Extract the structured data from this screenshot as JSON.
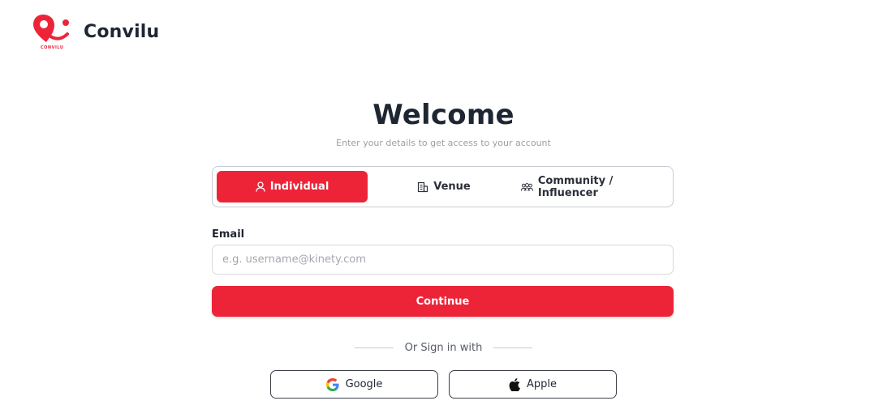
{
  "brand": {
    "name": "Convilu",
    "logo_text": "CONVILU",
    "accent": "#ed2438"
  },
  "header": {
    "title": "Welcome",
    "subtitle": "Enter your details to get access to your account"
  },
  "tabs": [
    {
      "label": "Individual",
      "icon": "person-icon",
      "active": true
    },
    {
      "label": "Venue",
      "icon": "building-icon",
      "active": false
    },
    {
      "label": "Community / Influencer",
      "icon": "group-icon",
      "active": false
    }
  ],
  "form": {
    "email_label": "Email",
    "email_placeholder": "e.g. username@kinety.com",
    "email_value": "",
    "continue_label": "Continue"
  },
  "divider_text": "Or Sign in with",
  "social": {
    "google_label": "Google",
    "apple_label": "Apple"
  }
}
